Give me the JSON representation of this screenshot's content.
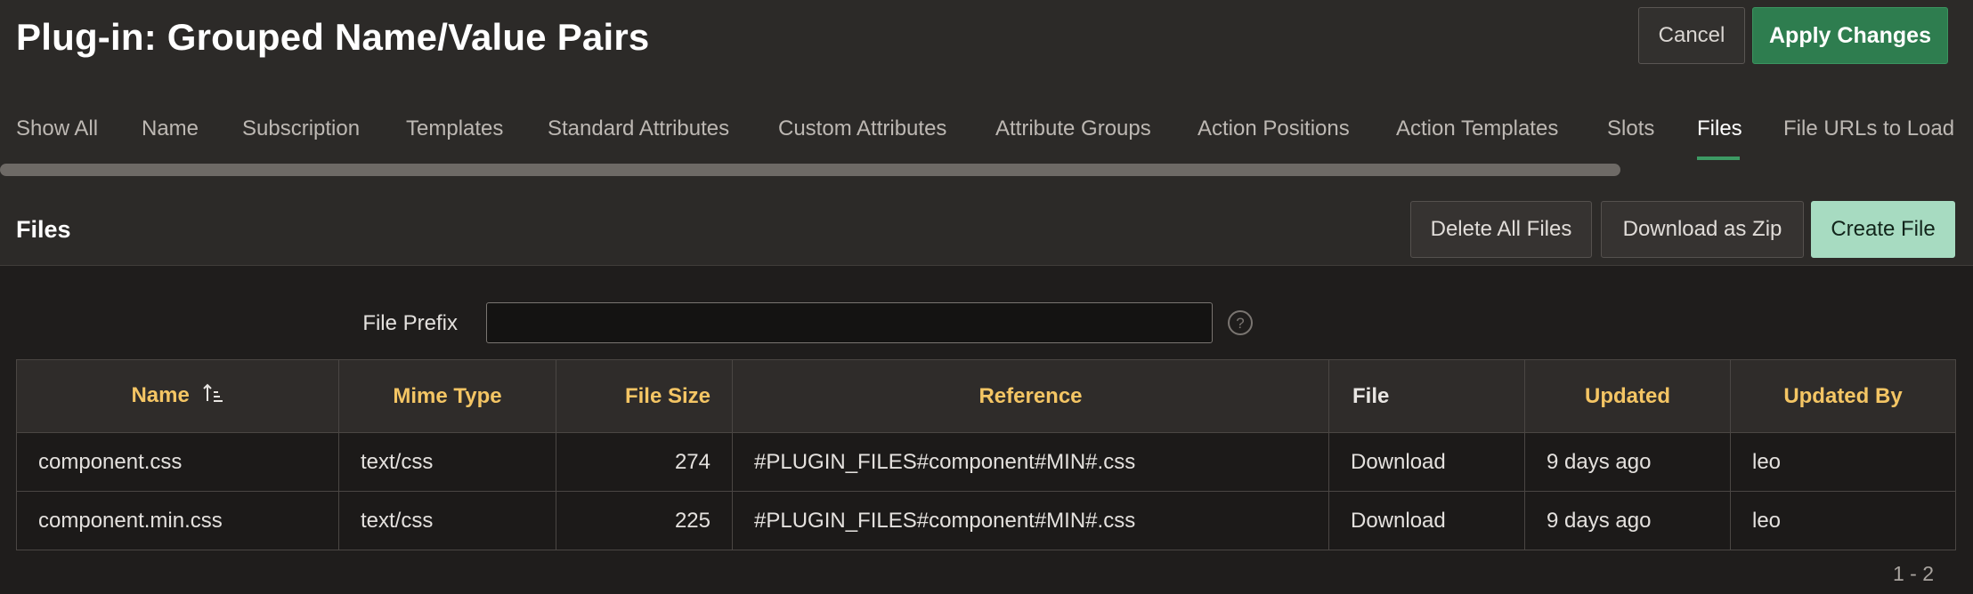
{
  "header": {
    "title": "Plug-in: Grouped Name/Value Pairs",
    "cancel_label": "Cancel",
    "apply_label": "Apply Changes"
  },
  "tabs": [
    {
      "label": "Show All"
    },
    {
      "label": "Name"
    },
    {
      "label": "Subscription"
    },
    {
      "label": "Templates"
    },
    {
      "label": "Standard Attributes"
    },
    {
      "label": "Custom Attributes"
    },
    {
      "label": "Attribute Groups"
    },
    {
      "label": "Action Positions"
    },
    {
      "label": "Action Templates"
    },
    {
      "label": "Slots"
    },
    {
      "label": "Files",
      "active": true
    },
    {
      "label": "File URLs to Load"
    }
  ],
  "region": {
    "title": "Files",
    "delete_all_label": "Delete All Files",
    "download_zip_label": "Download as Zip",
    "create_label": "Create File"
  },
  "filter": {
    "label": "File Prefix",
    "value": "",
    "help_icon": "help-circle-icon"
  },
  "table": {
    "columns": [
      "Name",
      "Mime Type",
      "File Size",
      "Reference",
      "File",
      "Updated",
      "Updated By"
    ],
    "sort_column": "Name",
    "sort_icon": "sort-ascending-icon",
    "rows": [
      {
        "name": "component.css",
        "mime": "text/css",
        "size": "274",
        "reference": "#PLUGIN_FILES#component#MIN#.css",
        "file": "Download",
        "updated": "9 days ago",
        "updated_by": "leo"
      },
      {
        "name": "component.min.css",
        "mime": "text/css",
        "size": "225",
        "reference": "#PLUGIN_FILES#component#MIN#.css",
        "file": "Download",
        "updated": "9 days ago",
        "updated_by": "leo"
      }
    ]
  },
  "pagination": "1 - 2",
  "colors": {
    "accent_green": "#2e7d4f",
    "create_button": "#a7dbc1",
    "link_gold": "#f4c564",
    "background": "#1f1d1c"
  }
}
